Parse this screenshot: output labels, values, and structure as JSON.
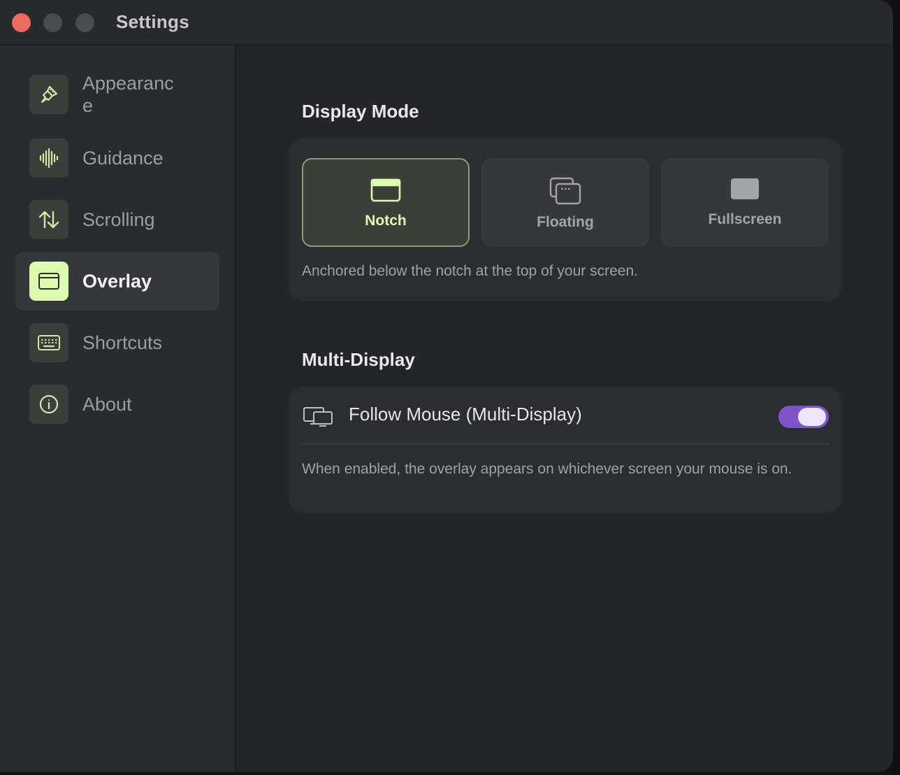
{
  "window": {
    "title": "Settings"
  },
  "sidebar": {
    "items": [
      {
        "label": "Appearance",
        "icon": "paintbrush-icon",
        "active": false
      },
      {
        "label": "Guidance",
        "icon": "waveform-icon",
        "active": false
      },
      {
        "label": "Scrolling",
        "icon": "up-down-arrows-icon",
        "active": false
      },
      {
        "label": "Overlay",
        "icon": "overlay-window-icon",
        "active": true
      },
      {
        "label": "Shortcuts",
        "icon": "keyboard-icon",
        "active": false
      },
      {
        "label": "About",
        "icon": "info-icon",
        "active": false
      }
    ]
  },
  "display_mode": {
    "title": "Display Mode",
    "options": [
      {
        "label": "Notch",
        "icon": "notch-window-icon",
        "selected": true
      },
      {
        "label": "Floating",
        "icon": "floating-windows-icon",
        "selected": false
      },
      {
        "label": "Fullscreen",
        "icon": "fullscreen-icon",
        "selected": false
      }
    ],
    "description": "Anchored below the notch at the top of your screen."
  },
  "multi_display": {
    "title": "Multi-Display",
    "follow_mouse_label": "Follow Mouse (Multi-Display)",
    "follow_mouse_enabled": true,
    "description": "When enabled, the overlay appears on whichever screen your mouse is on."
  },
  "colors": {
    "accent_green": "#dcfbb0",
    "toggle_purple": "#7b55c9",
    "close_red": "#ed6a5f"
  }
}
